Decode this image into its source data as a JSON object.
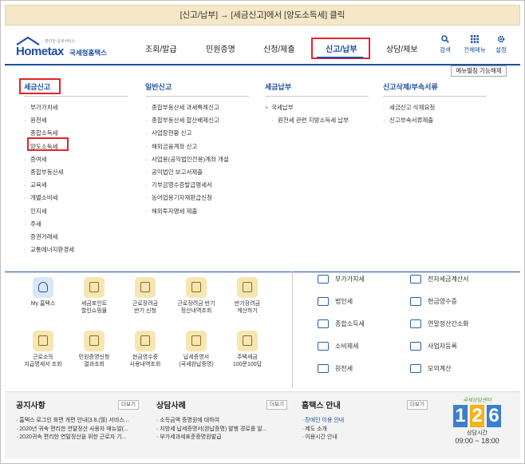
{
  "caption": "[신고/납부] → [세금신고]에서 [양도소득세] 클릭",
  "logo": {
    "tagline": "편리한 납세서비스",
    "brand": "Hometax",
    "brand_kr": "국세청홈택스"
  },
  "gnb": [
    "조회/발급",
    "민원증명",
    "신청/제출",
    "신고/납부",
    "상담/제보"
  ],
  "utils": [
    {
      "label": "검색",
      "icon": "search-icon"
    },
    {
      "label": "전체메뉴",
      "icon": "grid-icon"
    },
    {
      "label": "설정",
      "icon": "gear-icon"
    }
  ],
  "menu_off": "메뉴펼침 기능해제",
  "columns": [
    {
      "title": "세금신고",
      "items": [
        "부가가치세",
        "원천세",
        "종합소득세",
        "양도소득세",
        "증여세",
        "종합부동산세",
        "교육세",
        "개별소비세",
        "인지세",
        "주세",
        "증권거래세",
        "교통에너지환경세"
      ]
    },
    {
      "title": "일반신고",
      "items": [
        "종합부동산세 과세특례신고",
        "종합부동산세 합산배제신고",
        "사업장현황 신고",
        "해외금융계좌 신고",
        "사업용(공익법인전용)계좌 개설",
        "공익법인 보고서제출",
        "기부금영수증발급명세서",
        "농어업용기자재환급신청",
        "해외투자명세 제출"
      ]
    },
    {
      "title": "세금납부",
      "items": [
        "국세납부",
        "원천세 관련 지방소득세 납부"
      ]
    },
    {
      "title": "신고삭제/부속서류",
      "items": [
        "세금신고 삭제요청",
        "신고부속서류제출"
      ]
    }
  ],
  "quick_links": [
    [
      "My 홈택스"
    ],
    [
      "세금포인트",
      "할인쇼핑몰"
    ],
    [
      "근로장려금",
      "반기 신청"
    ],
    [
      "근로장려금 반기",
      "정산내역조회"
    ],
    [
      "반기장려금",
      "계산하기"
    ],
    [
      "근로소득",
      "지급명세서 조회"
    ],
    [
      "민원증명신청",
      "결과조회"
    ],
    [
      "현금영수증",
      "사용내역조회"
    ],
    [
      "납세증명서",
      "(국세완납증명)"
    ],
    [
      "주택세금",
      "100문100답"
    ]
  ],
  "services": [
    [
      "부가가치세",
      "전자세금계산서"
    ],
    [
      "법인세",
      "현금영수증"
    ],
    [
      "종합소득세",
      "연말정산간소화"
    ],
    [
      "소비제세",
      "사업자등록"
    ],
    [
      "원천세",
      "모의계산"
    ]
  ],
  "footer": {
    "notice": {
      "title": "공지사항",
      "more": "더보기",
      "items": [
        "홈택스 로그인 화면 개편 안내(3.8.(월) 서비스...",
        "2020년 귀속 편리한 연말정산 사용자 매뉴얼(...",
        "2020귀속 편리한 연말정산을 위한 근로자 기..."
      ]
    },
    "cases": {
      "title": "상담사례",
      "more": "더보기",
      "items": [
        "소득금액 증명원에 대하여",
        "지방세 납세증명서(완납증명) 발행 경로를 알...",
        "부가세과세표준증명원발급"
      ]
    },
    "guide": {
      "title": "홈택스 안내",
      "more": "더보기",
      "items": [
        "장애인 이용 안내",
        "제도 소개",
        "이용시간 안내"
      ]
    },
    "call": {
      "slogan": "국세상담센터",
      "number": "126",
      "hours_label": "상담시간",
      "hours": "09:00 ~ 18:00"
    }
  }
}
